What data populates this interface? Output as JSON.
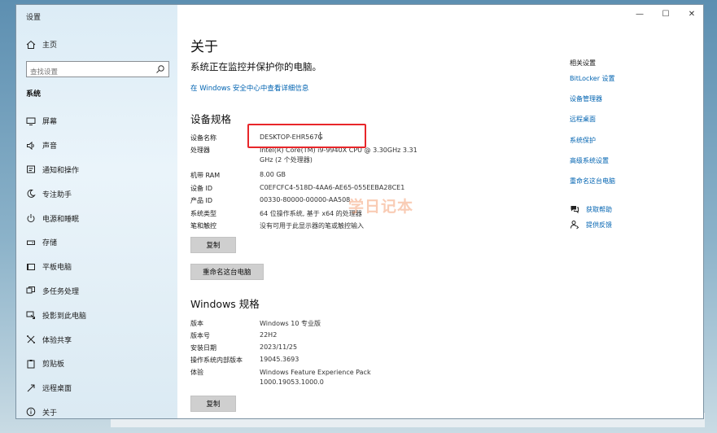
{
  "window": {
    "title": "设置",
    "controls": [
      "—",
      "☐",
      "✕"
    ]
  },
  "sidebar": {
    "home": "主页",
    "search_placeholder": "查找设置",
    "section": "系统",
    "items": [
      {
        "label": "屏幕",
        "icon": "monitor-icon"
      },
      {
        "label": "声音",
        "icon": "speaker-icon"
      },
      {
        "label": "通知和操作",
        "icon": "notification-icon"
      },
      {
        "label": "专注助手",
        "icon": "moon-icon"
      },
      {
        "label": "电源和睡眠",
        "icon": "power-icon"
      },
      {
        "label": "存储",
        "icon": "storage-icon"
      },
      {
        "label": "平板电脑",
        "icon": "tablet-icon"
      },
      {
        "label": "多任务处理",
        "icon": "multitask-icon"
      },
      {
        "label": "投影到此电脑",
        "icon": "project-icon"
      },
      {
        "label": "体验共享",
        "icon": "share-icon"
      },
      {
        "label": "剪贴板",
        "icon": "clipboard-icon"
      },
      {
        "label": "远程桌面",
        "icon": "remote-icon"
      },
      {
        "label": "关于",
        "icon": "info-icon"
      }
    ]
  },
  "main": {
    "title": "关于",
    "subtitle": "系统正在监控并保护你的电脑。",
    "security_link": "在 Windows 安全中心中查看详细信息",
    "device_specs": {
      "heading": "设备规格",
      "rows": [
        {
          "k": "设备名称",
          "v": "DESKTOP-EHR567G"
        },
        {
          "k": "处理器",
          "v": "Intel(R) Core(TM) i9-9940X CPU @ 3.30GHz   3.31 GHz  (2 个处理器)"
        },
        {
          "k": "机带 RAM",
          "v": "8.00 GB"
        },
        {
          "k": "设备 ID",
          "v": "C0EFCFC4-518D-4AA6-AE65-055EEBA28CE1"
        },
        {
          "k": "产品 ID",
          "v": "00330-80000-00000-AA508"
        },
        {
          "k": "系统类型",
          "v": "64 位操作系统, 基于 x64 的处理器"
        },
        {
          "k": "笔和触控",
          "v": "没有可用于此显示器的笔或触控输入"
        }
      ],
      "copy_button": "复制",
      "rename_button": "重命名这台电脑"
    },
    "windows_specs": {
      "heading": "Windows 规格",
      "rows": [
        {
          "k": "版本",
          "v": "Windows 10 专业版"
        },
        {
          "k": "版本号",
          "v": "22H2"
        },
        {
          "k": "安装日期",
          "v": "2023/11/25"
        },
        {
          "k": "操作系统内部版本",
          "v": "19045.3693"
        },
        {
          "k": "体验",
          "v": "Windows Feature Experience Pack 1000.19053.1000.0"
        }
      ],
      "copy_button": "复制"
    },
    "watermark": "学日记本"
  },
  "related": {
    "title": "相关设置",
    "links": [
      "BitLocker 设置",
      "设备管理器",
      "远程桌面",
      "系统保护",
      "高级系统设置",
      "重命名这台电脑"
    ]
  },
  "help": {
    "get_help": "获取帮助",
    "feedback": "提供反馈"
  },
  "colors": {
    "accent": "#0063b1",
    "highlight": "#e8262a",
    "sidebar_bg": "#e3f0f8"
  }
}
